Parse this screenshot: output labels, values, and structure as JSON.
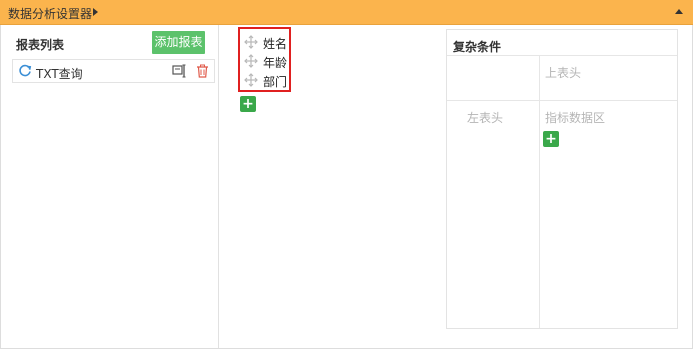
{
  "header": {
    "title": "数据分析设置器",
    "expand_icon": "triangle-right-icon",
    "collapse_icon": "triangle-up-icon"
  },
  "report_list": {
    "title": "报表列表",
    "add_button_label": "添加报表",
    "items": [
      {
        "label": "TXT查询",
        "icon": "refresh-icon",
        "actions": [
          "edit-icon",
          "delete-icon"
        ]
      }
    ]
  },
  "fields": {
    "items": [
      {
        "label": "姓名",
        "icon": "move-icon"
      },
      {
        "label": "年龄",
        "icon": "move-icon"
      },
      {
        "label": "部门",
        "icon": "move-icon"
      }
    ],
    "add_icon": "plus-icon"
  },
  "conditions": {
    "title": "复杂条件",
    "top_header": "上表头",
    "left_header": "左表头",
    "data_area": "指标数据区",
    "add_icon": "plus-icon"
  },
  "colors": {
    "header_bg": "#fbb44d",
    "add_button_bg": "#5cc26b",
    "plus_button_bg": "#3aa84a",
    "highlight_border": "#e02020",
    "delete_icon": "#e05a4a"
  }
}
